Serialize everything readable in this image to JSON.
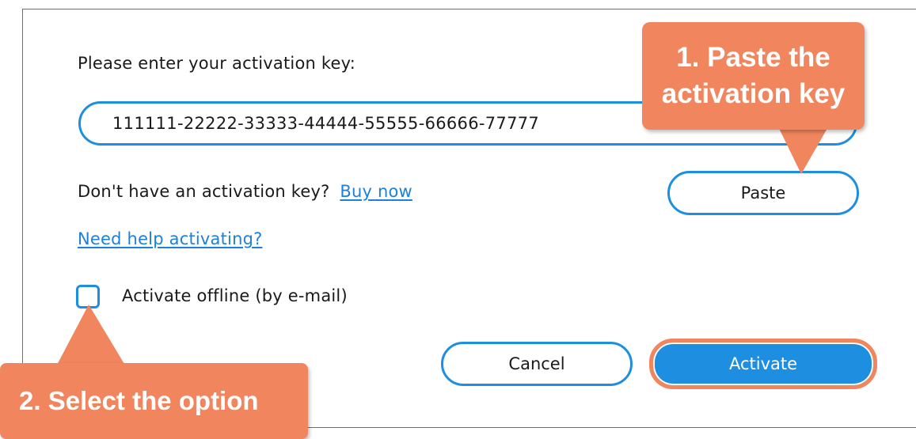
{
  "dialog": {
    "prompt_label": "Please enter your activation key:",
    "key_input": {
      "value": "111111-22222-33333-44444-55555-66666-77777",
      "placeholder": ""
    },
    "no_key_text": "Don't have an activation key?",
    "buy_now_link": "Buy now",
    "help_link": "Need help activating?",
    "offline_checkbox": {
      "label": "Activate offline (by e-mail)",
      "checked": false
    },
    "buttons": {
      "paste": "Paste",
      "cancel": "Cancel",
      "activate": "Activate"
    }
  },
  "callouts": {
    "step1_line1": "1. Paste the",
    "step1_line2": "activation key",
    "step2": "2. Select the option"
  },
  "colors": {
    "accent_blue": "#1e8fe0",
    "link_blue": "#1e80d8",
    "callout_orange": "#f1855e"
  }
}
